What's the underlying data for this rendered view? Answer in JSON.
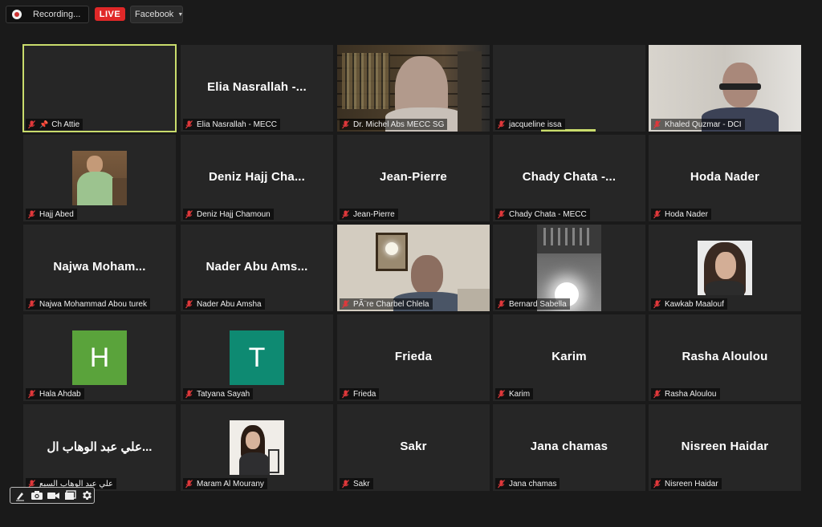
{
  "topbar": {
    "recording_label": "Recording...",
    "live_badge": "LIVE",
    "platform_label": "Facebook"
  },
  "tiles": [
    {
      "label": "Ch Attie",
      "big": "",
      "pinned": true,
      "kind": "blank",
      "active": true
    },
    {
      "label": "Elia Nasrallah - MECC",
      "big": "Elia  Nasrallah  -...",
      "kind": "name"
    },
    {
      "label": "Dr. Michel Abs MECC SG",
      "big": "",
      "kind": "video-library"
    },
    {
      "label": "jacqueline issa",
      "big": "",
      "kind": "blank",
      "speaking": true
    },
    {
      "label": "Khaled Quzmar - DCI",
      "big": "",
      "kind": "video-room"
    },
    {
      "label": "Hajj Abed",
      "big": "",
      "kind": "pic-man"
    },
    {
      "label": "Deniz Hajj Chamoun",
      "big": "Deniz  Hajj  Cha...",
      "kind": "name"
    },
    {
      "label": "Jean-Pierre",
      "big": "Jean-Pierre",
      "kind": "name"
    },
    {
      "label": "Chady Chata - MECC",
      "big": "Chady  Chata  -...",
      "kind": "name"
    },
    {
      "label": "Hoda Nader",
      "big": "Hoda Nader",
      "kind": "name"
    },
    {
      "label": "Najwa Mohammad Abou turek",
      "big": "Najwa  Moham...",
      "kind": "name"
    },
    {
      "label": "Nader Abu Amsha",
      "big": "Nader  Abu  Ams...",
      "kind": "name"
    },
    {
      "label": "PÃ¨re Charbel Chlela",
      "big": "",
      "kind": "video-office"
    },
    {
      "label": "Bernard Sabella",
      "big": "",
      "kind": "video-lamp"
    },
    {
      "label": "Kawkab Maalouf",
      "big": "",
      "kind": "pic-woman"
    },
    {
      "label": "Hala Ahdab",
      "big": "",
      "kind": "avatar",
      "letter": "H",
      "color": "#5aa33b"
    },
    {
      "label": "Tatyana Sayah",
      "big": "",
      "kind": "avatar",
      "letter": "T",
      "color": "#0e8a72"
    },
    {
      "label": "Frieda",
      "big": "Frieda",
      "kind": "name"
    },
    {
      "label": "Karim",
      "big": "Karim",
      "kind": "name"
    },
    {
      "label": "Rasha Aloulou",
      "big": "Rasha Aloulou",
      "kind": "name"
    },
    {
      "label": "علي عبد الوهاب السبع",
      "big": "علي عبد الوهاب ال...",
      "kind": "name"
    },
    {
      "label": "Maram Al Mourany",
      "big": "",
      "kind": "pic-girl"
    },
    {
      "label": "Sakr",
      "big": "Sakr",
      "kind": "name"
    },
    {
      "label": "Jana chamas",
      "big": "Jana chamas",
      "kind": "name"
    },
    {
      "label": "Nisreen Haidar",
      "big": "Nisreen Haidar",
      "kind": "name"
    }
  ],
  "controls": [
    "pen-icon",
    "camera-icon",
    "video-icon",
    "screen-icon",
    "gear-icon"
  ],
  "colors": {
    "active_border": "#c9dc6c",
    "live": "#e02828",
    "mute": "#e0383b"
  }
}
